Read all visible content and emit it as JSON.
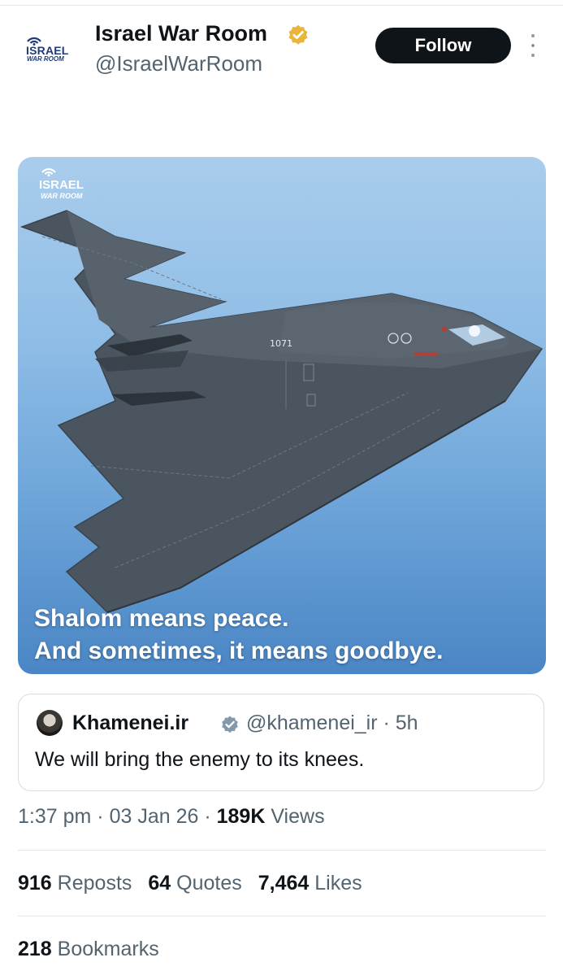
{
  "author": {
    "name": "Israel War Room",
    "handle": "@IsraelWarRoom",
    "avatar_text_top": "ISRAEL",
    "avatar_text_bottom": "WAR ROOM"
  },
  "follow_label": "Follow",
  "media": {
    "watermark_top": "ISRAEL",
    "watermark_bottom": "WAR ROOM",
    "tail_number": "1071",
    "caption_line1": "Shalom means peace.",
    "caption_line2": "And sometimes, it means goodbye."
  },
  "quoted": {
    "name": "Khamenei.ir",
    "handle": "@khamenei_ir",
    "age": "5h",
    "text": "We will bring the enemy to its knees."
  },
  "meta": {
    "time": "1:37 pm",
    "date": "03 Jan 26",
    "views_count": "189K",
    "views_label": "Views"
  },
  "stats": {
    "reposts_count": "916",
    "reposts_label": "Reposts",
    "quotes_count": "64",
    "quotes_label": "Quotes",
    "likes_count": "7,464",
    "likes_label": "Likes",
    "bookmarks_count": "218",
    "bookmarks_label": "Bookmarks"
  },
  "colors": {
    "verified_gold": "#e9b53a",
    "verified_gray": "#829aab",
    "text_primary": "#0f1419",
    "text_secondary": "#536471"
  }
}
